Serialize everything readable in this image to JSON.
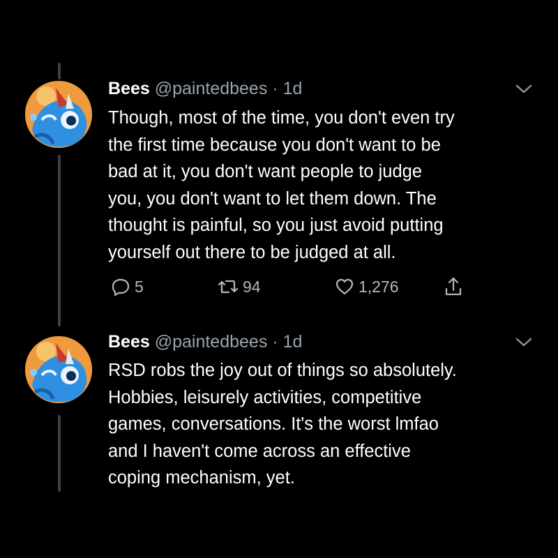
{
  "tweets": [
    {
      "display_name": "Bees",
      "handle": "@paintedbees",
      "separator": "·",
      "time": "1d",
      "lines": [
        "Though, most of the time, you don't even try",
        "the first time because you don't want to be",
        "bad at it, you don't want people to judge",
        "you, you don't want to let them down. The",
        "thought is painful, so you just avoid putting",
        "yourself out there to be judged at all."
      ],
      "replies": "5",
      "retweets": "94",
      "likes": "1,276"
    },
    {
      "display_name": "Bees",
      "handle": "@paintedbees",
      "separator": "·",
      "time": "1d",
      "lines": [
        "RSD robs the joy out of things so absolutely.",
        "Hobbies, leisurely activities, competitive",
        "games, conversations. It's the worst lmfao",
        "and I haven't come across an effective",
        "coping mechanism, yet."
      ]
    }
  ],
  "colors": {
    "background": "#000000",
    "text": "#ffffff",
    "secondary_text": "#9aa4ad",
    "thread_line": "#3d4145",
    "avatar_bg": "#f09a3e",
    "avatar_character": "#2f8fe0"
  },
  "icons": [
    "reply-icon",
    "retweet-icon",
    "like-icon",
    "share-icon",
    "chevron-down-icon"
  ]
}
